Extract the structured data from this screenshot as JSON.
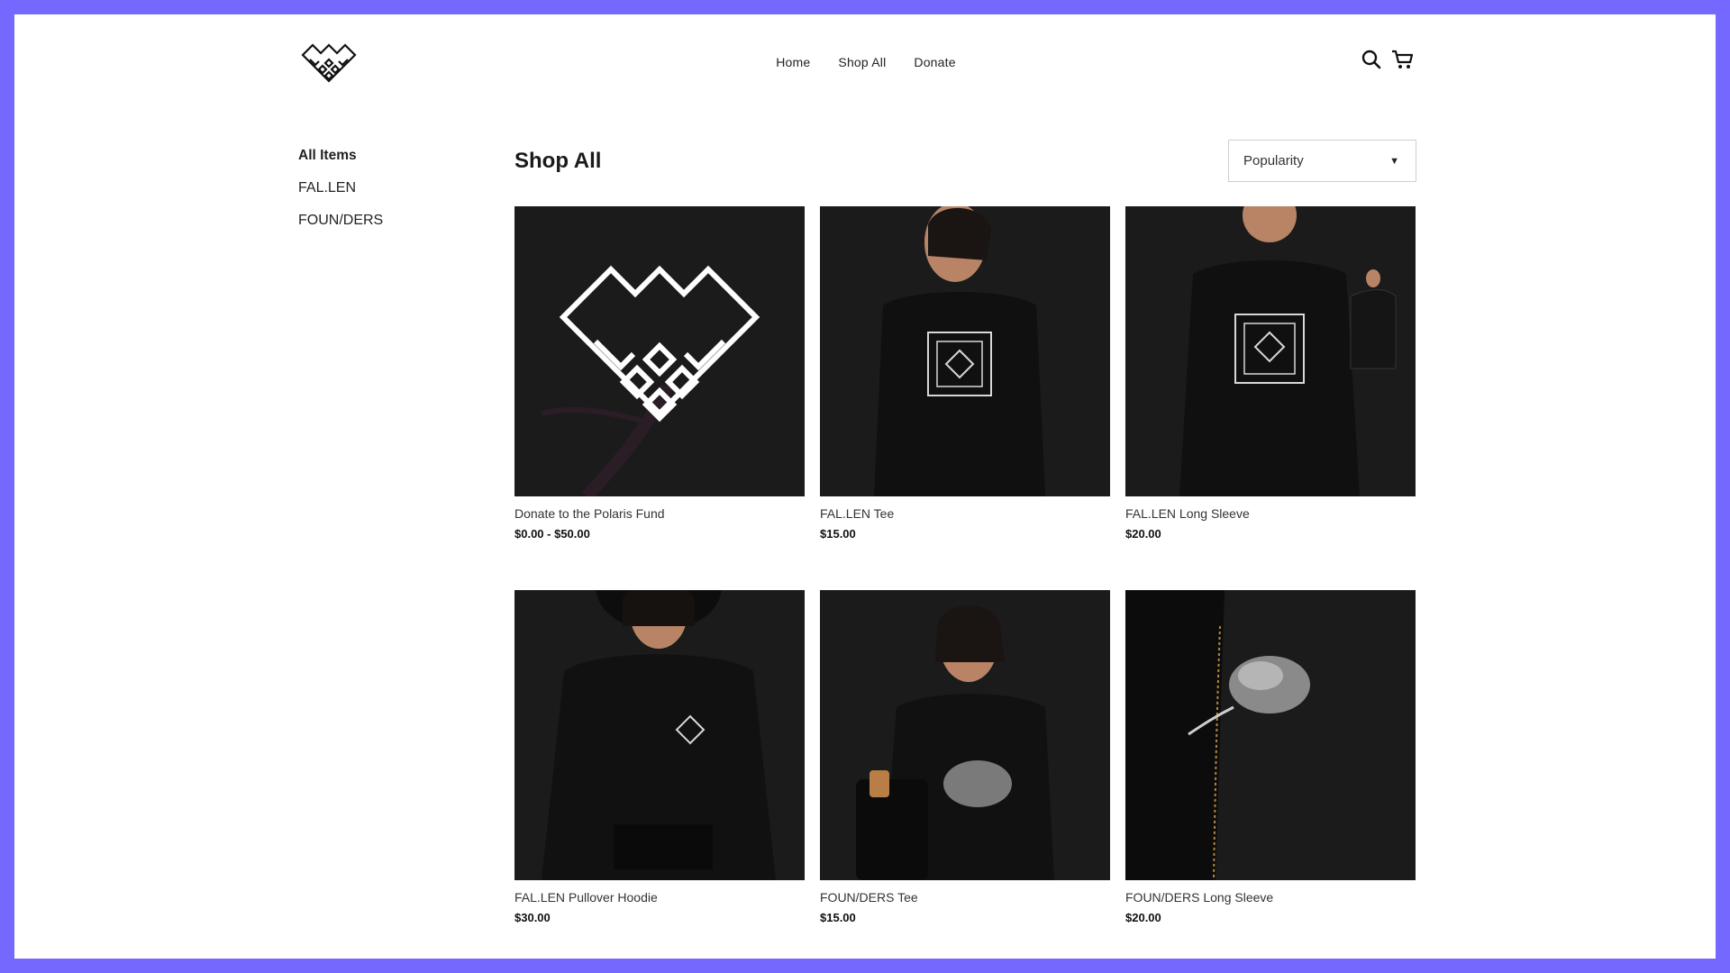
{
  "nav": {
    "items": [
      "Home",
      "Shop All",
      "Donate"
    ]
  },
  "icons": {
    "logo": "polaris-diamond-logo",
    "search": "search-icon",
    "cart": "cart-icon"
  },
  "sidebar": {
    "items": [
      {
        "label": "All Items",
        "active": true
      },
      {
        "label": "FAL.LEN",
        "active": false
      },
      {
        "label": "FOUN/DERS",
        "active": false
      }
    ]
  },
  "main": {
    "title": "Shop All",
    "sort": {
      "selected": "Popularity"
    }
  },
  "products": [
    {
      "name": "Donate to the Polaris Fund",
      "price": "$0.00 - $50.00"
    },
    {
      "name": "FAL.LEN Tee",
      "price": "$15.00"
    },
    {
      "name": "FAL.LEN Long Sleeve",
      "price": "$20.00"
    },
    {
      "name": "FAL.LEN Pullover Hoodie",
      "price": "$30.00"
    },
    {
      "name": "FOUN/DERS Tee",
      "price": "$15.00"
    },
    {
      "name": "FOUN/DERS Long Sleeve",
      "price": "$20.00"
    }
  ],
  "colors": {
    "frame": "#7468ff",
    "background": "#ffffff",
    "text": "#1a1a1a"
  }
}
